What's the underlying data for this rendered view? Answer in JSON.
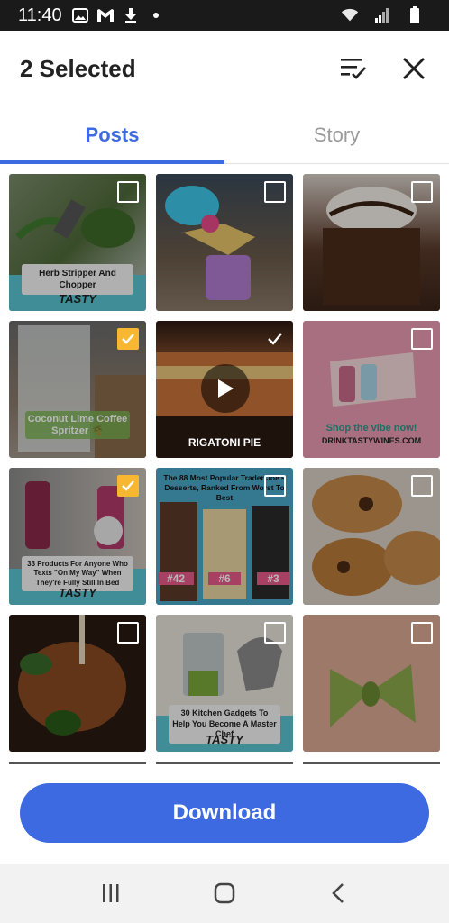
{
  "status_bar": {
    "time": "11:40",
    "left_icons": [
      "image-icon",
      "gmail-icon",
      "download-icon",
      "dot-icon"
    ],
    "right_icons": [
      "wifi-icon",
      "signal-icon",
      "battery-icon"
    ]
  },
  "header": {
    "title": "2 Selected",
    "sort_icon": "sort-check-icon",
    "close_icon": "close-icon"
  },
  "tabs": [
    {
      "label": "Posts",
      "active": true
    },
    {
      "label": "Story",
      "active": false
    }
  ],
  "tiles": [
    {
      "caption": "Herb Stripper And Chopper",
      "brand": "TASTY",
      "selected": false
    },
    {
      "caption": "",
      "brand": "",
      "selected": false
    },
    {
      "caption": "",
      "brand": "",
      "selected": false
    },
    {
      "caption": "Coconut Lime Coffee Spritzer 🌴",
      "brand": "",
      "selected": true
    },
    {
      "caption": "RIGATONI PIE",
      "brand": "",
      "selected": true,
      "video": true
    },
    {
      "caption": "Shop the vibe now!",
      "caption2": "DRINKTASTYWINES.COM",
      "brand": "",
      "selected": false
    },
    {
      "caption": "33 Products For Anyone Who Texts \"On My Way\" When They're Fully Still In Bed",
      "brand": "TASTY",
      "selected": true
    },
    {
      "caption": "The 88 Most Popular Trader Joe's Desserts, Ranked From Worst To Best",
      "labels": [
        "#42",
        "#6",
        "#3"
      ],
      "brand": "",
      "selected": false
    },
    {
      "caption": "",
      "brand": "",
      "selected": false
    },
    {
      "caption": "",
      "brand": "",
      "selected": false
    },
    {
      "caption": "30 Kitchen Gadgets To Help You Become A Master Chef",
      "brand": "TASTY",
      "selected": false
    },
    {
      "caption": "",
      "brand": "",
      "selected": false
    }
  ],
  "download_button": {
    "label": "Download"
  },
  "nav_bar": {
    "icons": [
      "recent-apps-icon",
      "home-icon",
      "back-icon"
    ]
  },
  "colors": {
    "accent": "#3d6ae0",
    "checked": "#f7b731",
    "tasty_teal": "#5bc4d2"
  }
}
